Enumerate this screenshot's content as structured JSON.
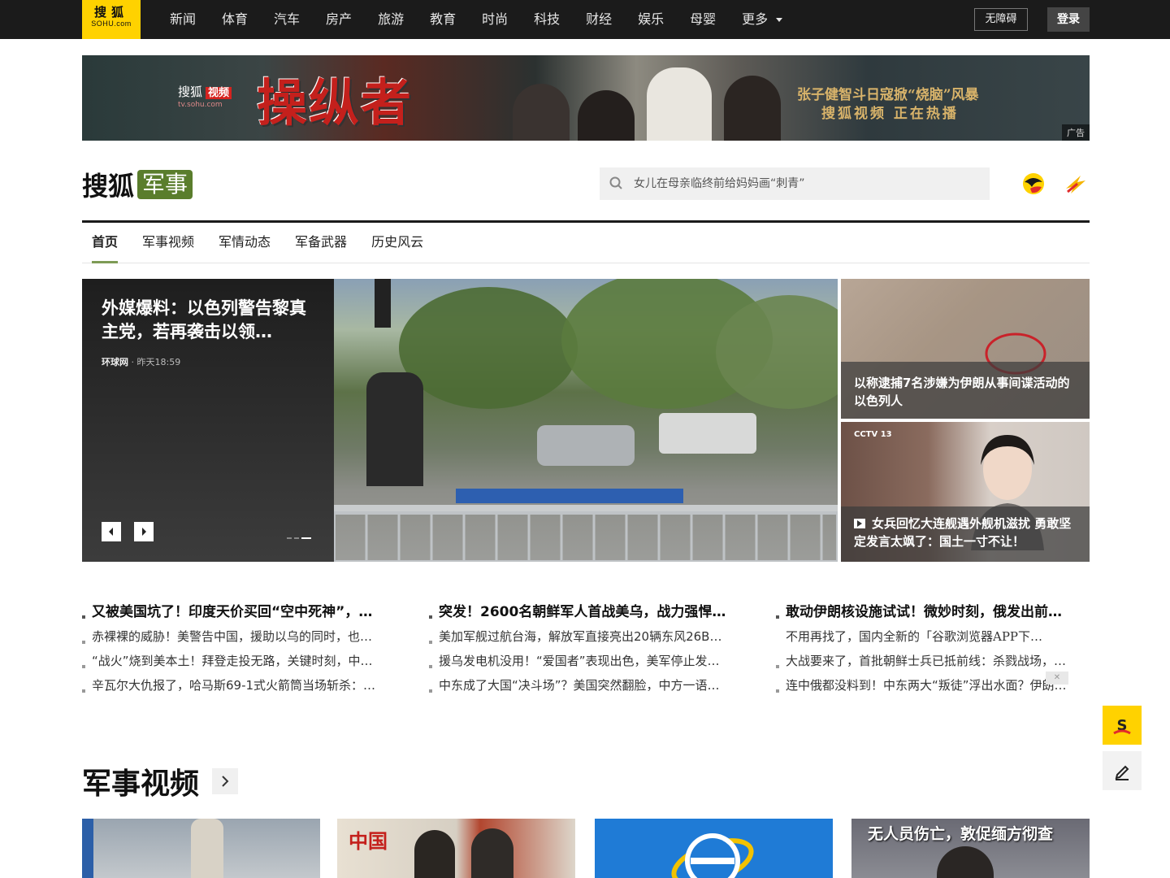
{
  "topbar": {
    "logo_line1": "搜狐",
    "logo_line2": "SOHU.com",
    "nav": [
      "新闻",
      "体育",
      "汽车",
      "房产",
      "旅游",
      "教育",
      "时尚",
      "科技",
      "财经",
      "娱乐",
      "母婴"
    ],
    "more_label": "更多",
    "accessibility_label": "无障碍",
    "login_label": "登录"
  },
  "banner": {
    "brand": "搜狐",
    "brand_tag": "视频",
    "brand_url": "tv.sohu.com",
    "title": "操纵者",
    "tagline1": "张子健智斗日寇掀“烧脑”风暴",
    "tagline2": "搜狐视频 正在热播",
    "ad_label": "广告"
  },
  "channel": {
    "site": "搜狐",
    "name": "军事",
    "search_placeholder": "女儿在母亲临终前给妈妈画“刺青”",
    "tabs": [
      "首页",
      "军事视频",
      "军情动态",
      "军备武器",
      "历史风云"
    ]
  },
  "hero": {
    "headline": "外媒爆料：以色列警告黎真主党，若再袭击以领…",
    "source": "环球网",
    "time": " · 昨天18:59"
  },
  "side": [
    {
      "caption": "以称逮捕7名涉嫌为伊朗从事间谍活动的以色列人"
    },
    {
      "caption": "女兵回忆大连舰遇外舰机滋扰 勇敢坚定发言太飒了：国土一寸不让！",
      "badge": "CCTV 13"
    }
  ],
  "news": [
    [
      "又被美国坑了！印度天价买回“空中死神”，…",
      "赤裸裸的威胁！美警告中国，援助以乌的同时，也…",
      "“战火”烧到美本土！拜登走投无路，关键时刻，中…",
      "辛瓦尔大仇报了，哈马斯69-1式火箭筒当场斩杀：…"
    ],
    [
      "突发！2600名朝鲜军人首战美乌，战力强悍…",
      "美加军舰过航台海，解放军直接亮出20辆东风26B…",
      "援乌发电机没用！“爱国者”表现出色，美军停止发…",
      "中东成了大国“决斗场”？美国突然翻脸，中方一语…"
    ],
    [
      "敢动伊朗核设施试试！微妙时刻，俄发出前…",
      "不用再找了，国内全新的「谷歌浏览器APP下…",
      "大战要来了，首批朝鲜士兵已抵前线：杀戮战场，…",
      "连中俄都没料到！中东两大“叛徒”浮出水面？伊朗…"
    ]
  ],
  "section": {
    "title": "军事视频",
    "thumbs": [
      {
        "caption": ""
      },
      {
        "caption": "",
        "mark": "中国"
      },
      {
        "caption": ""
      },
      {
        "caption": "无人员伤亡，敦促缅方彻查"
      }
    ]
  },
  "colors": {
    "topbar": "#1b1b1b",
    "brand_yellow": "#ffd200",
    "channel_green": "#5a7d2c",
    "tab_underline": "#7e9b55"
  }
}
